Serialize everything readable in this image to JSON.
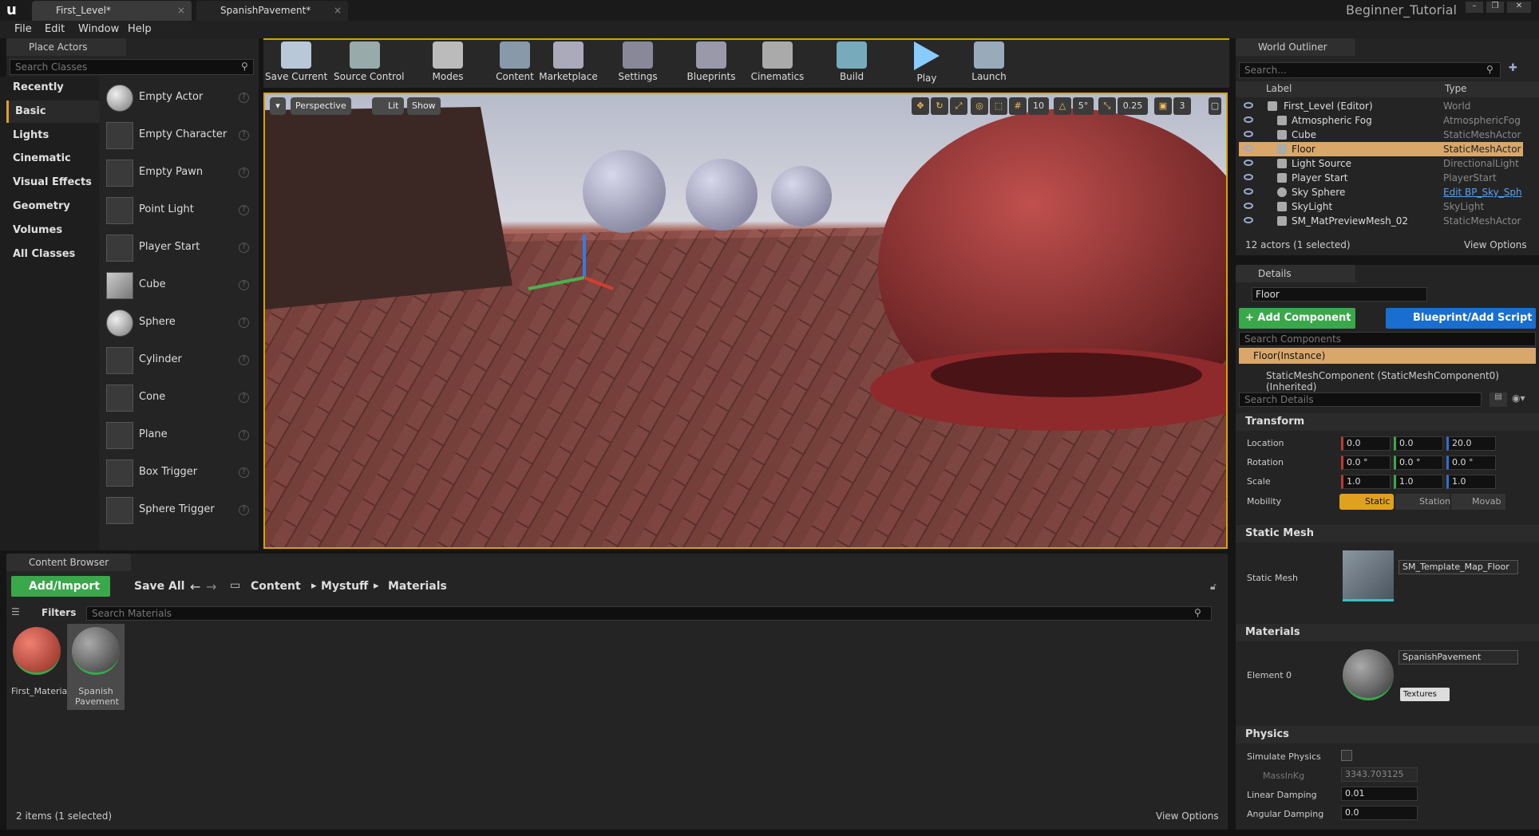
{
  "tabs": [
    {
      "label": "First_Level*"
    },
    {
      "label": "SpanishPavement*"
    }
  ],
  "project_name": "Beginner_Tutorial",
  "menu": [
    "File",
    "Edit",
    "Window",
    "Help"
  ],
  "place_actors": {
    "title": "Place Actors",
    "search_placeholder": "Search Classes",
    "categories": [
      "Recently Placed",
      "Basic",
      "Lights",
      "Cinematic",
      "Visual Effects",
      "Geometry",
      "Volumes",
      "All Classes"
    ],
    "items": [
      "Empty Actor",
      "Empty Character",
      "Empty Pawn",
      "Point Light",
      "Player Start",
      "Cube",
      "Sphere",
      "Cylinder",
      "Cone",
      "Plane",
      "Box Trigger",
      "Sphere Trigger"
    ]
  },
  "toolbar": [
    "Save Current",
    "Source Control",
    "Modes",
    "Content",
    "Marketplace",
    "Settings",
    "Blueprints",
    "Cinematics",
    "Build",
    "Play",
    "Launch"
  ],
  "viewport": {
    "perspective": "Perspective",
    "lit": "Lit",
    "show": "Show",
    "grid_snap": "10",
    "rot_snap": "5°",
    "scale_snap": "0.25",
    "cam_speed": "3"
  },
  "outliner": {
    "title": "World Outliner",
    "search_placeholder": "Search...",
    "col_label": "Label",
    "col_type": "Type",
    "rows": [
      {
        "name": "First_Level (Editor)",
        "type": "World"
      },
      {
        "name": "Atmospheric Fog",
        "type": "AtmosphericFog"
      },
      {
        "name": "Cube",
        "type": "StaticMeshActor"
      },
      {
        "name": "Floor",
        "type": "StaticMeshActor"
      },
      {
        "name": "Light Source",
        "type": "DirectionalLight"
      },
      {
        "name": "Player Start",
        "type": "PlayerStart"
      },
      {
        "name": "Sky Sphere",
        "type": "Edit BP_Sky_Sph"
      },
      {
        "name": "SkyLight",
        "type": "SkyLight"
      },
      {
        "name": "SM_MatPreviewMesh_02",
        "type": "StaticMeshActor"
      }
    ],
    "footer": "12 actors (1 selected)",
    "view_options": "View Options"
  },
  "details": {
    "title": "Details",
    "name": "Floor",
    "add_component": "+ Add Component",
    "blueprint": "Blueprint/Add Script",
    "search_components": "Search Components",
    "instance": "Floor(Instance)",
    "component": "StaticMeshComponent (StaticMeshComponent0) (Inherited)",
    "search_details": "Search Details",
    "transform": "Transform",
    "location_label": "Location",
    "rotation_label": "Rotation",
    "scale_label": "Scale",
    "mobility_label": "Mobility",
    "location": [
      "0.0",
      "0.0",
      "20.0"
    ],
    "rotation": [
      "0.0 °",
      "0.0 °",
      "0.0 °"
    ],
    "scale": [
      "1.0",
      "1.0",
      "1.0"
    ],
    "mobility": [
      "Static",
      "Station",
      "Movab"
    ],
    "static_mesh_section": "Static Mesh",
    "static_mesh_label": "Static Mesh",
    "static_mesh_value": "SM_Template_Map_Floor",
    "materials_section": "Materials",
    "element0": "Element 0",
    "material_value": "SpanishPavement",
    "textures": "Textures",
    "physics_section": "Physics",
    "simulate_physics": "Simulate Physics",
    "mass_label": "MassInKg",
    "mass_value": "3343.703125",
    "linear_damping": "Linear Damping",
    "linear_value": "0.01",
    "angular_damping": "Angular Damping",
    "angular_value": "0.0"
  },
  "content_browser": {
    "title": "Content Browser",
    "add_import": "Add/Import",
    "save_all": "Save All",
    "path": [
      "Content",
      "Mystuff",
      "Materials"
    ],
    "filters": "Filters",
    "search_placeholder": "Search Materials",
    "assets": [
      {
        "name": "First_Material"
      },
      {
        "name": "Spanish Pavement"
      }
    ],
    "footer": "2 items (1 selected)",
    "view_options": "View Options"
  }
}
